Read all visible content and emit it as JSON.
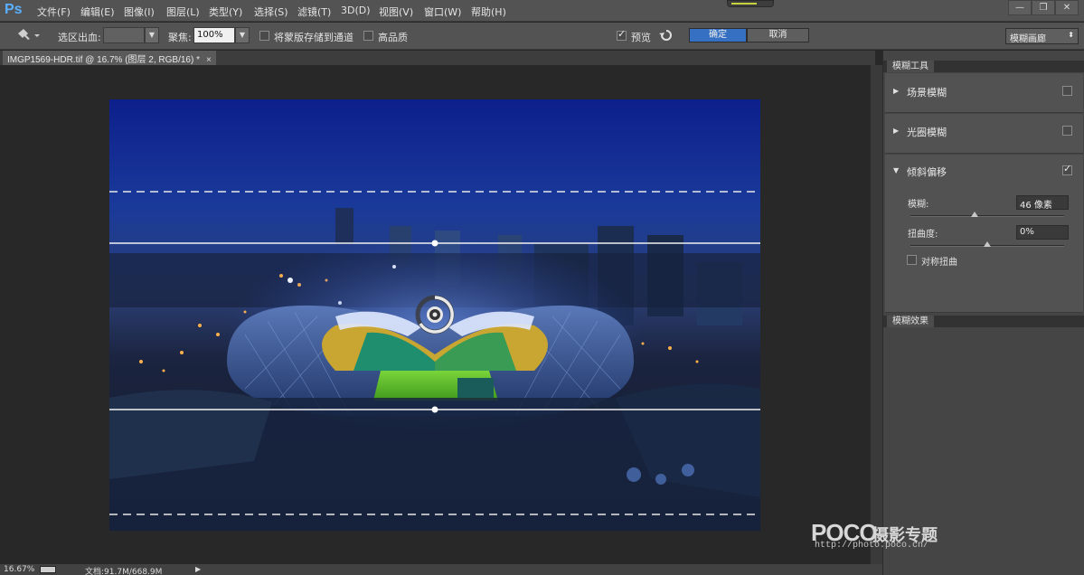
{
  "app": {
    "logo": "Ps"
  },
  "menu": [
    "文件(F)",
    "编辑(E)",
    "图像(I)",
    "图层(L)",
    "类型(Y)",
    "选择(S)",
    "滤镜(T)",
    "3D(D)",
    "视图(V)",
    "窗口(W)",
    "帮助(H)"
  ],
  "window_controls": [
    "—",
    "❐",
    "✕"
  ],
  "options": {
    "selection_bleed_label": "选区出血:",
    "focus_label": "聚焦:",
    "focus_value": "100%",
    "save_mask_label": "将蒙版存储到通道",
    "high_quality_label": "高品质",
    "preview_label": "预览",
    "preview_checked": true,
    "ok_label": "确定",
    "cancel_label": "取消",
    "workspace": "模糊画廊"
  },
  "document": {
    "tab_title": "IMGP1569-HDR.tif @ 16.7% (图层 2, RGB/16) *",
    "close": "×"
  },
  "status": {
    "zoom": "16.67%",
    "doc_info": "文档:91.7M/668.9M"
  },
  "blur_tools_panel": {
    "tab": "模糊工具",
    "sections": [
      {
        "label": "场景模糊",
        "expanded": false,
        "enabled": false
      },
      {
        "label": "光圈模糊",
        "expanded": false,
        "enabled": false
      },
      {
        "label": "倾斜偏移",
        "expanded": true,
        "enabled": true
      }
    ],
    "blur_label": "模糊:",
    "blur_value": "46 像素",
    "blur_level": 0.42,
    "distortion_label": "扭曲度:",
    "distortion_value": "0%",
    "distortion_level": 0.5,
    "symmetric_label": "对称扭曲"
  },
  "blur_effects_panel": {
    "tab": "模糊效果"
  },
  "watermark": {
    "brand": "POCO",
    "subtitle": "摄影专题",
    "url": "http://photo.poco.cn/"
  },
  "colors": {
    "accent": "#3570c2",
    "ps_blue": "#5ab0ff"
  }
}
